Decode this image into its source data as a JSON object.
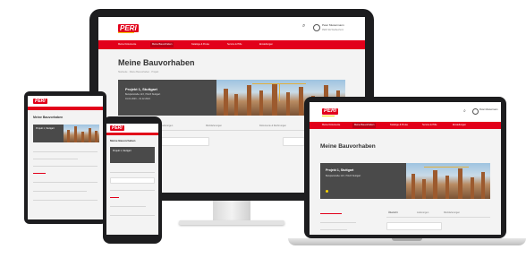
{
  "brand": {
    "logo_text": "PERI",
    "primary_color": "#e2001a",
    "accent_color": "#f4d100",
    "dark_panel": "#4a4a4a"
  },
  "header": {
    "user_name": "Peter Mustermann",
    "user_company": "PERI SE Weißenhorn",
    "search_icon": "search-icon",
    "avatar_icon": "user-avatar-icon"
  },
  "nav": {
    "items": [
      "Meine Dokumente",
      "Meine Bauvorhaben",
      "Kataloge & Preise",
      "Service & Hilfe",
      "Einstellungen"
    ],
    "active_index": 1
  },
  "page": {
    "title": "Meine Bauvorhaben",
    "breadcrumb": "Startseite · Meine Bauvorhaben · Projekt",
    "project_title": "Projekt 1, Stuttgart",
    "project_address": "Beispielstraße 123, 70123 Stuttgart",
    "project_period": "01.01.2023 – 31.12.2024",
    "tabs": [
      "Übersicht",
      "Lieferungen",
      "Rücklieferungen",
      "Dokumente & Rechnungen"
    ],
    "search_placeholder": "Suche nach Bauvorhaben",
    "filters": [
      "Aktiv",
      "Inaktiv",
      "Alle"
    ]
  }
}
